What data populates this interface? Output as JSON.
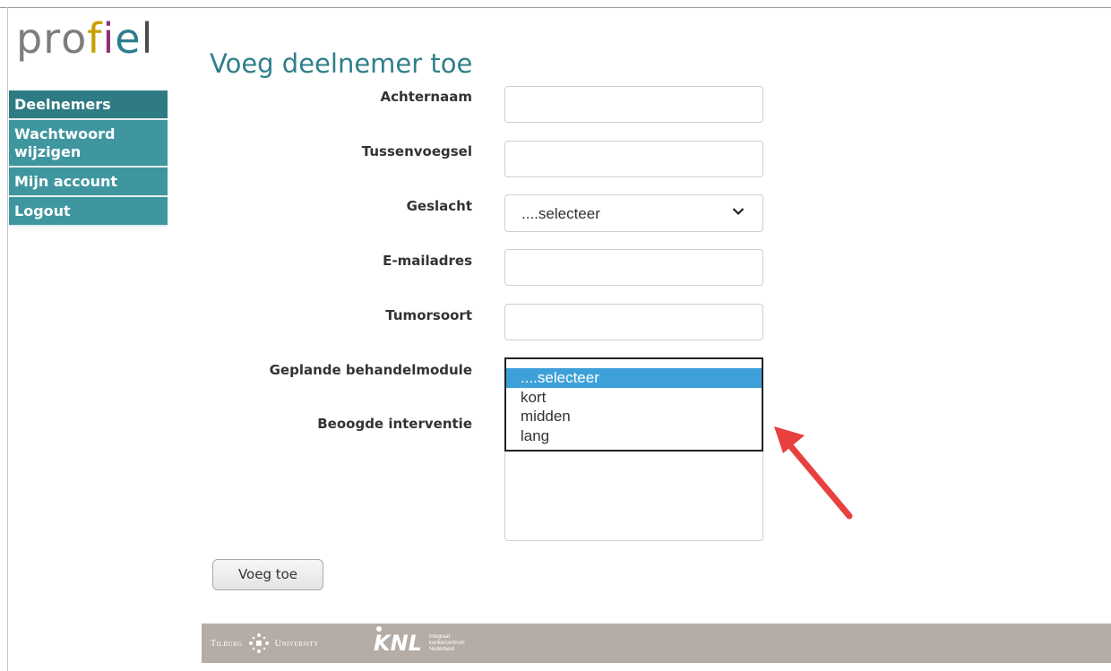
{
  "brand": {
    "logo_text": [
      "p",
      "r",
      "o",
      "f",
      "i",
      "e",
      "l"
    ]
  },
  "sidebar": {
    "items": [
      {
        "label": "Deelnemers"
      },
      {
        "label": "Wachtwoord wijzigen"
      },
      {
        "label": "Mijn account"
      },
      {
        "label": "Logout"
      }
    ]
  },
  "page": {
    "title": "Voeg deelnemer toe"
  },
  "form": {
    "achternaam_label": "Achternaam",
    "achternaam_value": "",
    "tussenvoegsel_label": "Tussenvoegsel",
    "tussenvoegsel_value": "",
    "geslacht_label": "Geslacht",
    "geslacht_value": "....selecteer",
    "email_label": "E-mailadres",
    "email_value": "",
    "tumorsoort_label": "Tumorsoort",
    "tumorsoort_value": "",
    "behandelmodule_label": "Geplande behandelmodule",
    "behandelmodule_options": [
      "....selecteer",
      "kort",
      "midden",
      "lang"
    ],
    "behandelmodule_selected": "....selecteer",
    "interventie_label": "Beoogde interventie",
    "interventie_value": "",
    "submit_label": "Voeg toe"
  },
  "footer": {
    "tilburg_left": "Tilburg",
    "tilburg_right": "University",
    "knl_mark": "KNL",
    "knl_line1": "integraal",
    "knl_line2": "kankercentrum",
    "knl_line3": "Nederland"
  },
  "colors": {
    "nav": "#3f969f",
    "title": "#2f7f8a",
    "highlight": "#3ea0d9",
    "footer": "#b4aca5",
    "arrow": "#e8403f"
  },
  "icons": {
    "dropdown": "chevron-down-icon",
    "annotation": "red-arrow-icon"
  }
}
